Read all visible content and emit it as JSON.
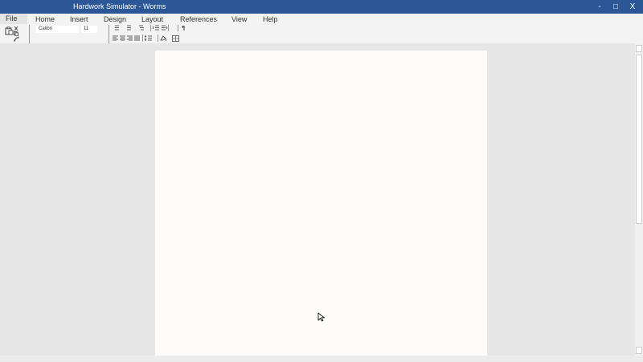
{
  "window": {
    "title": "Hardwork Simulator - Worms",
    "minimize_label": "-",
    "maximize_label": "□",
    "close_label": "X"
  },
  "menu": {
    "tabs": [
      "File",
      "Home",
      "Insert",
      "Design",
      "Layout",
      "References",
      "View",
      "Help"
    ]
  },
  "ribbon": {
    "font_name": "Calibri",
    "font_size": "11",
    "pilcrow": "¶"
  },
  "colors": {
    "titlebar": "#2b5797",
    "workspace": "#e6e6e6",
    "page": "#fdfcfa"
  }
}
